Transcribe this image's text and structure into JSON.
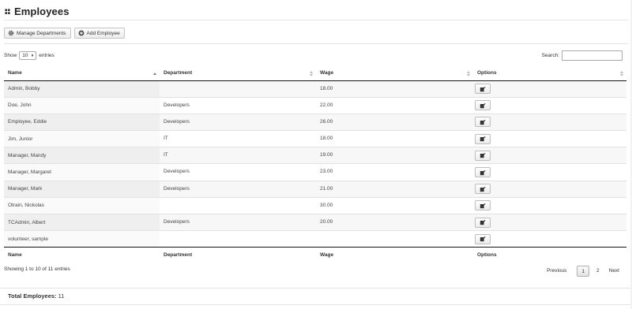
{
  "page": {
    "title": "Employees",
    "title_icon": "users-icon"
  },
  "toolbar": {
    "manage_departments_label": "Manage Departments",
    "manage_departments_icon": "gear-icon",
    "add_employee_label": "Add Employee",
    "add_employee_icon": "plus-circle-icon"
  },
  "length_menu": {
    "prefix": "Show",
    "selected": "10",
    "suffix": "entries"
  },
  "search": {
    "label": "Search:",
    "value": ""
  },
  "table": {
    "columns": [
      "Name",
      "Department",
      "Wage",
      "Options"
    ],
    "sorted_column": "Name",
    "rows": [
      {
        "name": "Admin, Bobby",
        "department": "",
        "wage": "18.00"
      },
      {
        "name": "Doe, John",
        "department": "Developers",
        "wage": "22.00"
      },
      {
        "name": "Employee, Eddie",
        "department": "Developers",
        "wage": "26.00"
      },
      {
        "name": "Jim, Junior",
        "department": "IT",
        "wage": "18.00"
      },
      {
        "name": "Manager, Mandy",
        "department": "IT",
        "wage": "19.00"
      },
      {
        "name": "Manager, Margaret",
        "department": "Developers",
        "wage": "23.00"
      },
      {
        "name": "Manager, Mark",
        "department": "Developers",
        "wage": "21.00"
      },
      {
        "name": "Otrain, Nickolas",
        "department": "",
        "wage": "30.00"
      },
      {
        "name": "TCAdmin, Albert",
        "department": "Developers",
        "wage": "20.00"
      },
      {
        "name": "volunteer, sample",
        "department": "",
        "wage": ""
      }
    ],
    "row_action_icon": "edit-icon"
  },
  "info": "Showing 1 to 10 of 11 entries",
  "pagination": {
    "previous": "Previous",
    "pages": [
      "1",
      "2"
    ],
    "current": "1",
    "next": "Next"
  },
  "footer": {
    "total_label": "Total Employees:",
    "total_value": "11"
  }
}
